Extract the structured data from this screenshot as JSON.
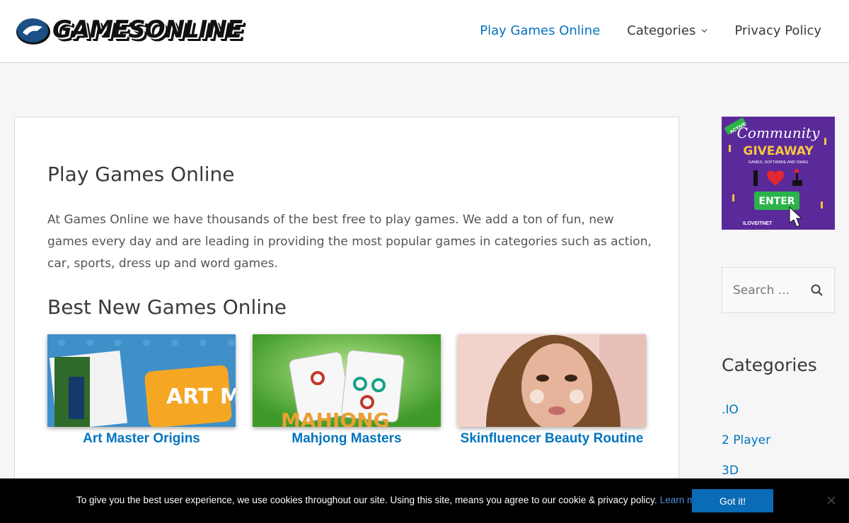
{
  "header": {
    "logo_text": "GAMESONLINE",
    "nav": [
      {
        "label": "Play Games Online",
        "active": true
      },
      {
        "label": "Categories",
        "has_dropdown": true
      },
      {
        "label": "Privacy Policy"
      }
    ]
  },
  "main": {
    "title": "Play Games Online",
    "intro": "At Games Online we have thousands of the best free to play games. We add a ton of fun, new games every day and are leading in providing the most popular games in categories such as action, car, sports, dress up and word games.",
    "section_title": "Best New Games Online",
    "games": [
      {
        "title": "Art Master Origins",
        "thumb_text": "ART MASTERS"
      },
      {
        "title": "Mahjong Masters",
        "thumb_text": "MAHJONG"
      },
      {
        "title": "Skinfluencer Beauty Routine"
      }
    ]
  },
  "sidebar": {
    "ad": {
      "badge": "ACTIVE",
      "title": "Community",
      "subtitle": "GIVEAWAY",
      "tagline": "GAMES, SOFTWARE AND SWAG",
      "button": "ENTER",
      "brand": "ILOVEITNET"
    },
    "search_placeholder": "Search ...",
    "categories_title": "Categories",
    "categories": [
      ".IO",
      "2 Player",
      "3D"
    ]
  },
  "cookie": {
    "text": "To give you the best user experience, we use cookies throughout our site. Using this site, means you agree to our cookie & privacy policy.",
    "learn_more": "Learn more",
    "button": "Got it!"
  },
  "colors": {
    "accent": "#0274be",
    "cookie_bg": "#000000",
    "ad_bg": "#5b2a9a"
  }
}
